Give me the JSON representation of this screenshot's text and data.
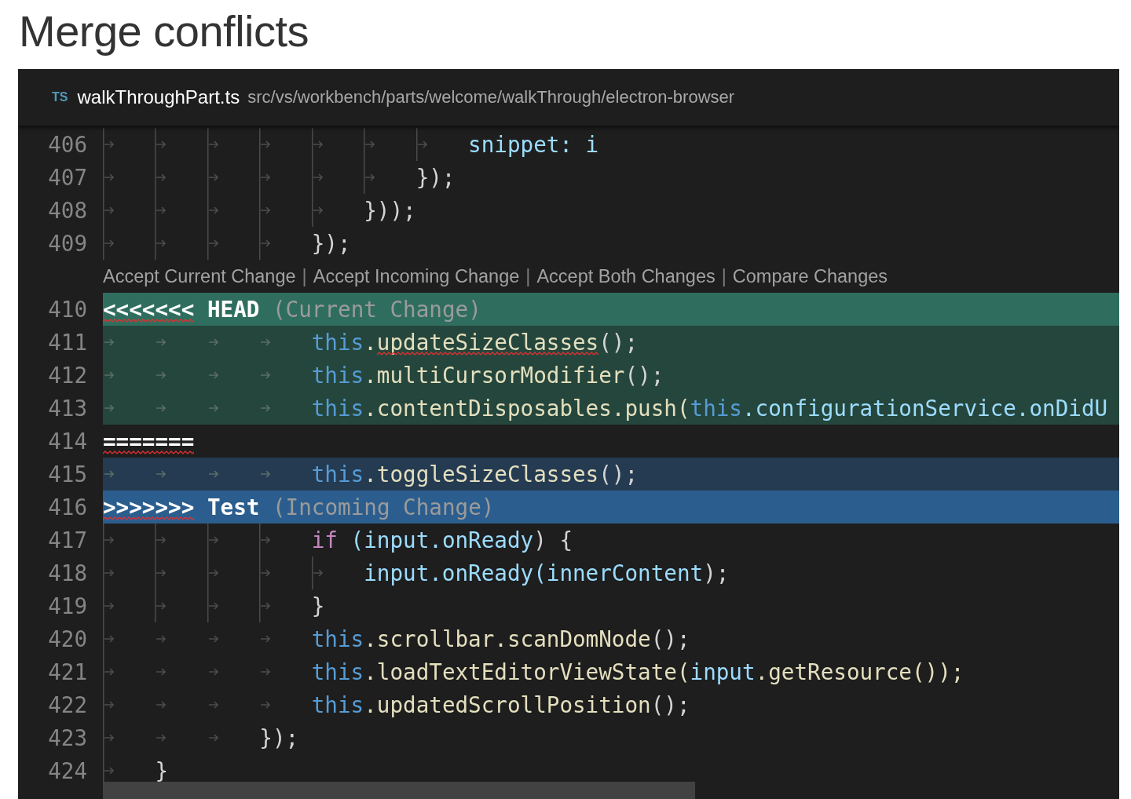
{
  "heading": "Merge conflicts",
  "editor": {
    "tab": {
      "badge": "TS",
      "file_name": "walkThroughPart.ts",
      "path": "src/vs/workbench/parts/welcome/walkThrough/electron-browser"
    },
    "lines": [
      {
        "kind": "normal",
        "number": "406",
        "tabs": [
          {
            "guide": true
          },
          {
            "guide": true
          },
          {
            "guide": true
          },
          {
            "guide": true
          },
          {
            "guide": true
          },
          {
            "guide": true
          },
          {
            "guide": true
          }
        ],
        "tokens": [
          {
            "text": "snippet: i",
            "kind": "variable",
            "squiggle": false
          }
        ]
      },
      {
        "kind": "normal",
        "number": "407",
        "tabs": [
          {
            "guide": true
          },
          {
            "guide": true
          },
          {
            "guide": true
          },
          {
            "guide": true
          },
          {
            "guide": true
          },
          {
            "guide": true
          }
        ],
        "tokens": [
          {
            "text": "});",
            "kind": "plain",
            "squiggle": false
          }
        ]
      },
      {
        "kind": "normal",
        "number": "408",
        "tabs": [
          {
            "guide": true
          },
          {
            "guide": true
          },
          {
            "guide": true
          },
          {
            "guide": true
          },
          {
            "guide": true
          }
        ],
        "tokens": [
          {
            "text": "}));",
            "kind": "plain",
            "squiggle": false
          }
        ]
      },
      {
        "kind": "normal",
        "number": "409",
        "tabs": [
          {
            "guide": true
          },
          {
            "guide": true
          },
          {
            "guide": true
          },
          {
            "guide": true
          }
        ],
        "tokens": [
          {
            "text": "});",
            "kind": "plain",
            "squiggle": false
          }
        ]
      },
      {
        "kind": "codelens",
        "items": [
          {
            "kind": "action",
            "text": "Accept Current Change"
          },
          {
            "kind": "separator",
            "text": "|"
          },
          {
            "kind": "action",
            "text": "Accept Incoming Change"
          },
          {
            "kind": "separator",
            "text": "|"
          },
          {
            "kind": "action",
            "text": "Accept Both Changes"
          },
          {
            "kind": "separator",
            "text": "|"
          },
          {
            "kind": "action",
            "text": "Compare Changes"
          }
        ]
      },
      {
        "kind": "current-header",
        "number": "410",
        "tokens": [
          {
            "text": "<<<<<<<",
            "kind": "marker",
            "squiggle": true
          },
          {
            "text": " HEAD",
            "kind": "marker",
            "squiggle": false
          },
          {
            "text": " (Current Change)",
            "kind": "label",
            "squiggle": false
          }
        ]
      },
      {
        "kind": "current",
        "number": "411",
        "tabs": [
          {
            "guide": false
          },
          {
            "guide": false
          },
          {
            "guide": false
          },
          {
            "guide": false
          }
        ],
        "tokens": [
          {
            "text": "this",
            "kind": "keyword",
            "squiggle": false
          },
          {
            "text": ".updateSizeClasses",
            "kind": "function",
            "squiggle": true
          },
          {
            "text": "();",
            "kind": "plain",
            "squiggle": false
          }
        ]
      },
      {
        "kind": "current",
        "number": "412",
        "tabs": [
          {
            "guide": false
          },
          {
            "guide": false
          },
          {
            "guide": false
          },
          {
            "guide": false
          }
        ],
        "tokens": [
          {
            "text": "this",
            "kind": "keyword",
            "squiggle": false
          },
          {
            "text": ".multiCursorModifier",
            "kind": "function",
            "squiggle": false
          },
          {
            "text": "();",
            "kind": "plain",
            "squiggle": false
          }
        ]
      },
      {
        "kind": "current",
        "number": "413",
        "tabs": [
          {
            "guide": false
          },
          {
            "guide": false
          },
          {
            "guide": false
          },
          {
            "guide": false
          }
        ],
        "tokens": [
          {
            "text": "this",
            "kind": "keyword",
            "squiggle": false
          },
          {
            "text": ".contentDisposables.push(",
            "kind": "function",
            "squiggle": false
          },
          {
            "text": "this",
            "kind": "keyword",
            "squiggle": false
          },
          {
            "text": ".configurationService.onDidU",
            "kind": "variable",
            "squiggle": false
          }
        ]
      },
      {
        "kind": "separator",
        "number": "414",
        "tokens": [
          {
            "text": "=======",
            "kind": "marker",
            "squiggle": true
          }
        ]
      },
      {
        "kind": "incoming",
        "number": "415",
        "tabs": [
          {
            "guide": false
          },
          {
            "guide": false
          },
          {
            "guide": false
          },
          {
            "guide": false
          }
        ],
        "tokens": [
          {
            "text": "this",
            "kind": "keyword",
            "squiggle": false
          },
          {
            "text": ".toggleSizeClasses",
            "kind": "function",
            "squiggle": false
          },
          {
            "text": "();",
            "kind": "plain",
            "squiggle": false
          }
        ]
      },
      {
        "kind": "incoming-header",
        "number": "416",
        "tokens": [
          {
            "text": ">>>>>>>",
            "kind": "marker",
            "squiggle": true
          },
          {
            "text": " Test",
            "kind": "marker",
            "squiggle": false
          },
          {
            "text": " (Incoming Change)",
            "kind": "label",
            "squiggle": false
          }
        ]
      },
      {
        "kind": "normal",
        "number": "417",
        "tabs": [
          {
            "guide": true
          },
          {
            "guide": true
          },
          {
            "guide": true
          },
          {
            "guide": true
          }
        ],
        "tokens": [
          {
            "text": "if",
            "kind": "control",
            "squiggle": false
          },
          {
            "text": " (input.onReady",
            "kind": "variable",
            "squiggle": false
          },
          {
            "text": ") {",
            "kind": "plain",
            "squiggle": false
          }
        ]
      },
      {
        "kind": "normal",
        "number": "418",
        "tabs": [
          {
            "guide": true
          },
          {
            "guide": true
          },
          {
            "guide": true
          },
          {
            "guide": true
          },
          {
            "guide": true
          }
        ],
        "tokens": [
          {
            "text": "input.onReady",
            "kind": "variable",
            "squiggle": false
          },
          {
            "text": "(innerContent",
            "kind": "variable",
            "squiggle": false
          },
          {
            "text": ");",
            "kind": "plain",
            "squiggle": false
          }
        ]
      },
      {
        "kind": "normal",
        "number": "419",
        "tabs": [
          {
            "guide": true
          },
          {
            "guide": true
          },
          {
            "guide": true
          },
          {
            "guide": true
          }
        ],
        "tokens": [
          {
            "text": "}",
            "kind": "plain",
            "squiggle": false
          }
        ]
      },
      {
        "kind": "normal",
        "number": "420",
        "tabs": [
          {
            "guide": true
          },
          {
            "guide": false
          },
          {
            "guide": false
          },
          {
            "guide": false
          }
        ],
        "tokens": [
          {
            "text": "this",
            "kind": "keyword",
            "squiggle": false
          },
          {
            "text": ".scrollbar.scanDomNode",
            "kind": "function",
            "squiggle": false
          },
          {
            "text": "();",
            "kind": "plain",
            "squiggle": false
          }
        ]
      },
      {
        "kind": "normal",
        "number": "421",
        "tabs": [
          {
            "guide": true
          },
          {
            "guide": false
          },
          {
            "guide": false
          },
          {
            "guide": false
          }
        ],
        "tokens": [
          {
            "text": "this",
            "kind": "keyword",
            "squiggle": false
          },
          {
            "text": ".loadTextEditorViewState(",
            "kind": "function",
            "squiggle": false
          },
          {
            "text": "input",
            "kind": "variable",
            "squiggle": false
          },
          {
            "text": ".getResource());",
            "kind": "function",
            "squiggle": false
          }
        ]
      },
      {
        "kind": "normal",
        "number": "422",
        "tabs": [
          {
            "guide": true
          },
          {
            "guide": false
          },
          {
            "guide": false
          },
          {
            "guide": false
          }
        ],
        "tokens": [
          {
            "text": "this",
            "kind": "keyword",
            "squiggle": false
          },
          {
            "text": ".updatedScrollPosition",
            "kind": "function",
            "squiggle": false
          },
          {
            "text": "();",
            "kind": "plain",
            "squiggle": false
          }
        ]
      },
      {
        "kind": "normal",
        "number": "423",
        "tabs": [
          {
            "guide": true
          },
          {
            "guide": false
          },
          {
            "guide": false
          }
        ],
        "tokens": [
          {
            "text": "});",
            "kind": "plain",
            "squiggle": false
          }
        ]
      },
      {
        "kind": "normal",
        "number": "424",
        "tabs": [
          {
            "guide": true
          }
        ],
        "tokens": [
          {
            "text": "}",
            "kind": "plain",
            "squiggle": false
          }
        ]
      }
    ]
  }
}
